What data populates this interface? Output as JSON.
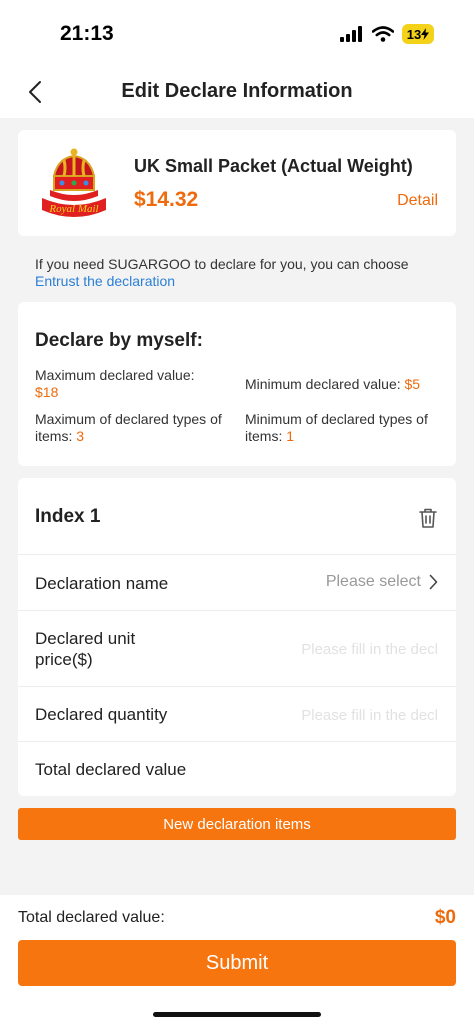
{
  "status_bar": {
    "time": "21:13",
    "battery": "13"
  },
  "header": {
    "title": "Edit Declare Information"
  },
  "shipping": {
    "name": "UK Small Packet (Actual Weight)",
    "price": "$14.32",
    "detail_label": "Detail",
    "logo_text": "Royal Mail"
  },
  "entrust": {
    "text": "If you need SUGARGOO to declare for you, you can choose",
    "link_label": "Entrust the declaration"
  },
  "declare": {
    "title": "Declare by myself:",
    "max_value_label": "Maximum declared value:",
    "max_value": "$18",
    "min_value_label": "Minimum declared value:",
    "min_value": "$5",
    "max_types_label": "Maximum of declared types of items:",
    "max_types": "3",
    "min_types_label": "Minimum of declared types of items:",
    "min_types": "1"
  },
  "index_item": {
    "title": "Index 1",
    "name_label": "Declaration name",
    "name_placeholder": "Please select",
    "unit_price_label": "Declared unit price($)",
    "unit_price_placeholder": "Please fill in the decl",
    "quantity_label": "Declared quantity",
    "quantity_placeholder": "Please fill in the decl",
    "total_label": "Total declared value"
  },
  "new_items_label": "New declaration items",
  "footer": {
    "total_label": "Total declared value:",
    "total_value": "$0",
    "submit_label": "Submit"
  },
  "colors": {
    "accent": "#f7750f",
    "price": "#ee6a0c",
    "link": "#2b7fd6"
  }
}
